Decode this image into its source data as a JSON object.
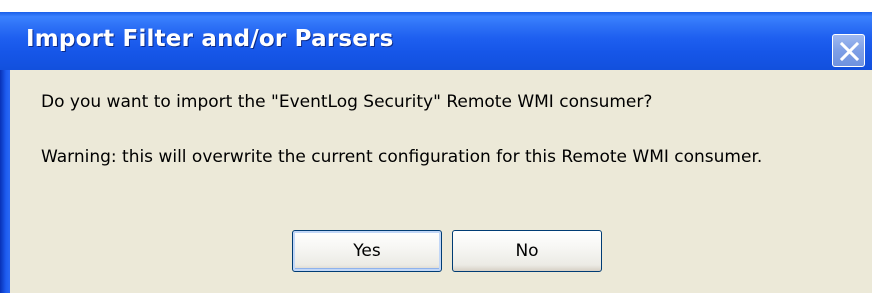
{
  "window": {
    "title": "Import Filter and/or Parsers"
  },
  "message": {
    "question": "Do you want to import the \"EventLog Security\" Remote WMI consumer?",
    "warning": "Warning: this will overwrite the current configuration for this Remote WMI consumer."
  },
  "buttons": {
    "yes_label": "Yes",
    "no_label": "No"
  },
  "icons": {
    "close": "close-icon"
  },
  "colors": {
    "titlebar": "#1e5ff0",
    "client_background": "#ece9d8",
    "button_border": "#003c74"
  }
}
